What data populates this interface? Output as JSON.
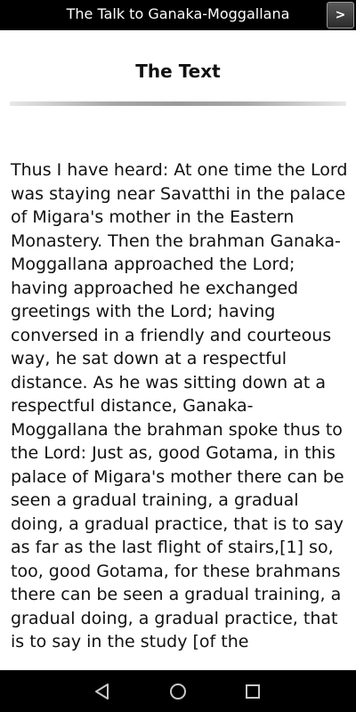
{
  "header": {
    "title": "The Talk to Ganaka-Moggallana",
    "next_label": ">"
  },
  "main": {
    "heading": "The Text",
    "paragraph": "Thus I have heard: At one time the Lord was staying near Savatthi in the palace of Migara's mother in the Eastern Monastery. Then the brahman Ganaka-Moggallana approached the Lord; having approached he exchanged greetings with the Lord; having conversed in a friendly and courteous way, he sat down at a respectful distance. As he was sitting down at a respectful distance, Ganaka-Moggallana the brahman spoke thus to the Lord: Just as, good Gotama, in this palace of Migara's mother there can be seen a gradual training, a gradual doing, a gradual practice, that is to say as far as the last flight of stairs,[1] so, too, good Gotama, for these brahmans there can be seen a gradual training, a gradual doing, a gradual practice, that is to say in the study [of the"
  },
  "navbar": {
    "icons": [
      "back-icon",
      "home-icon",
      "recents-icon"
    ]
  },
  "colors": {
    "bar_background": "#000000",
    "page_background": "#ffffff",
    "text": "#111111",
    "nav_icon": "#c8c8c8"
  }
}
